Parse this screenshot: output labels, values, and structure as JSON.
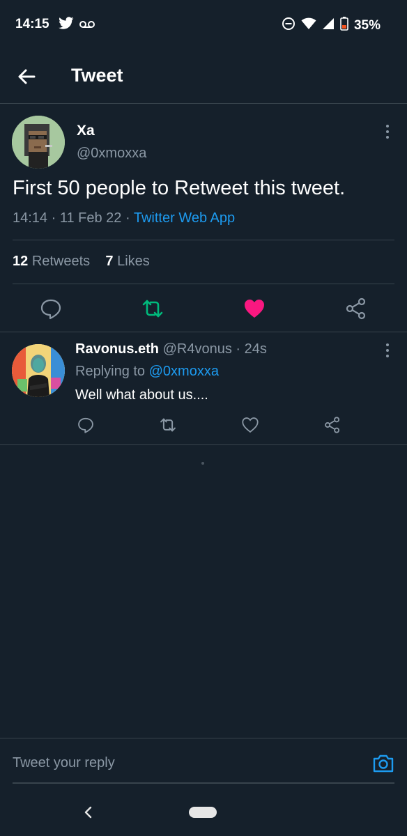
{
  "status_bar": {
    "time": "14:15",
    "battery_percent": "35%",
    "icons": [
      "twitter-icon",
      "voicemail-icon",
      "do-not-disturb-icon",
      "wifi-icon",
      "signal-icon",
      "battery-icon"
    ]
  },
  "header": {
    "title": "Tweet"
  },
  "tweet": {
    "author_name": "Xa",
    "author_handle": "@0xmoxxa",
    "text": "First 50 people to Retweet this tweet.",
    "time": "14:14",
    "date": "11 Feb 22",
    "source": "Twitter Web App",
    "retweets_count": "12",
    "retweets_label": "Retweets",
    "likes_count": "7",
    "likes_label": "Likes",
    "retweeted": true,
    "liked": true
  },
  "reply": {
    "author_name": "Ravonus.eth",
    "author_handle": "@R4vonus",
    "age": "24s",
    "replying_to_label": "Replying to",
    "replying_to_handle": "@0xmoxxa",
    "text": "Well what about us...."
  },
  "reply_bar": {
    "placeholder": "Tweet your reply"
  },
  "colors": {
    "background": "#15202b",
    "accent": "#1d9bf0",
    "retweet_green": "#00ba7c",
    "like_pink": "#f91880",
    "muted": "#8b98a5",
    "divider": "#38444d"
  }
}
